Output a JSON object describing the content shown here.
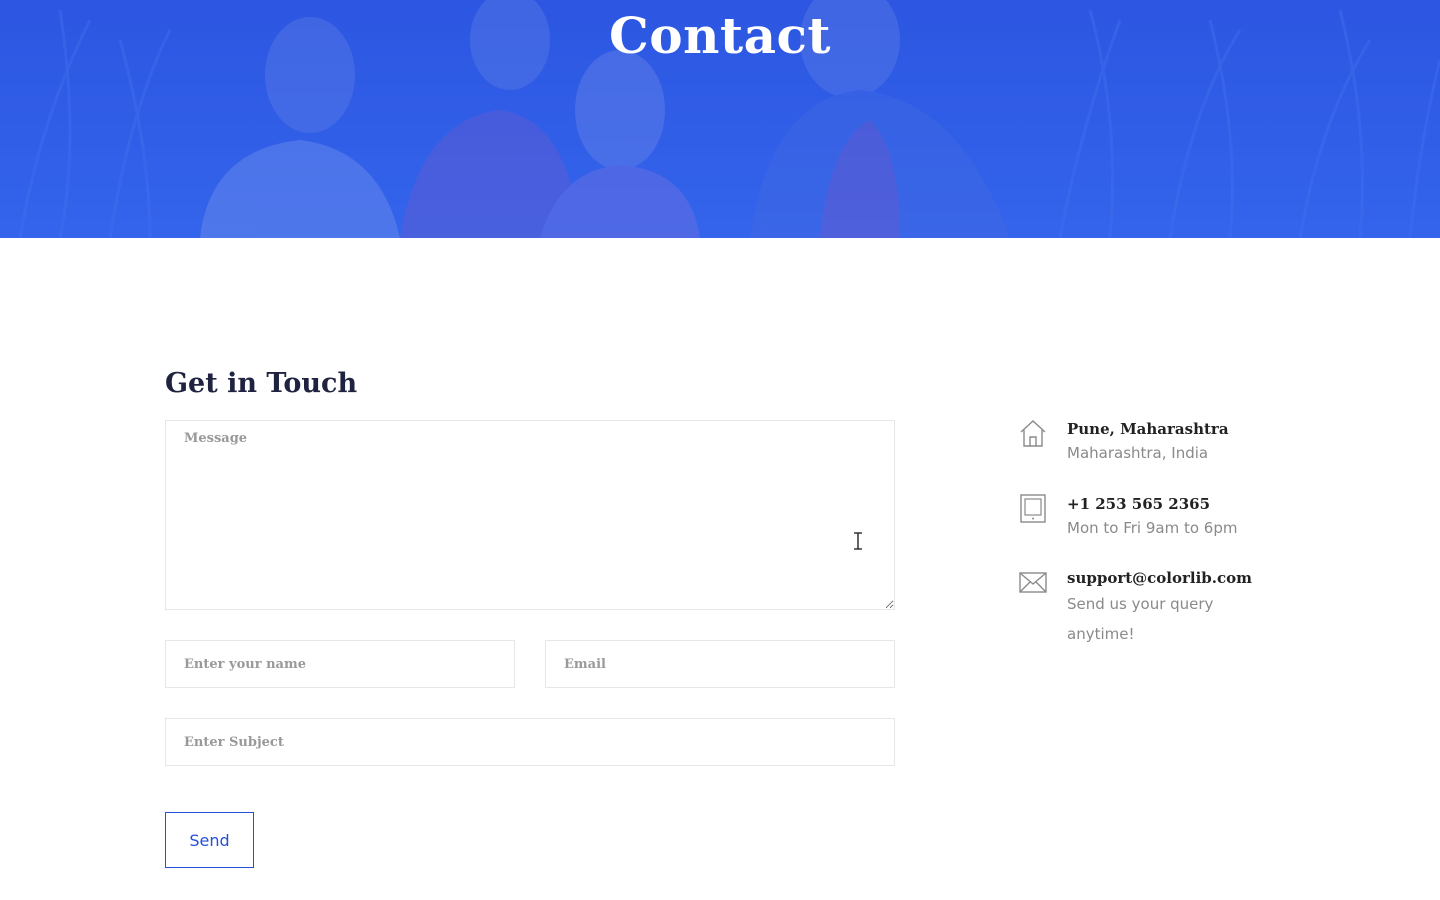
{
  "hero": {
    "title": "Contact"
  },
  "form": {
    "heading": "Get in Touch",
    "message_placeholder": "Message",
    "name_placeholder": "Enter your name",
    "email_placeholder": "Email",
    "subject_placeholder": "Enter Subject",
    "send_label": "Send"
  },
  "contact_info": [
    {
      "icon": "home-icon",
      "title": "Pune, Maharashtra",
      "subtitle": "Maharashtra, India"
    },
    {
      "icon": "tablet-icon",
      "title": "+1 253 565 2365",
      "subtitle": "Mon to Fri 9am to 6pm"
    },
    {
      "icon": "email-icon",
      "title": "support@colorlib.com",
      "subtitle": "Send us your query anytime!"
    }
  ],
  "colors": {
    "hero_overlay": "#3163e8",
    "accent": "#2450d8",
    "heading": "#1f2340",
    "muted_text": "#8a8a8a",
    "field_border": "#e5e6e9"
  }
}
